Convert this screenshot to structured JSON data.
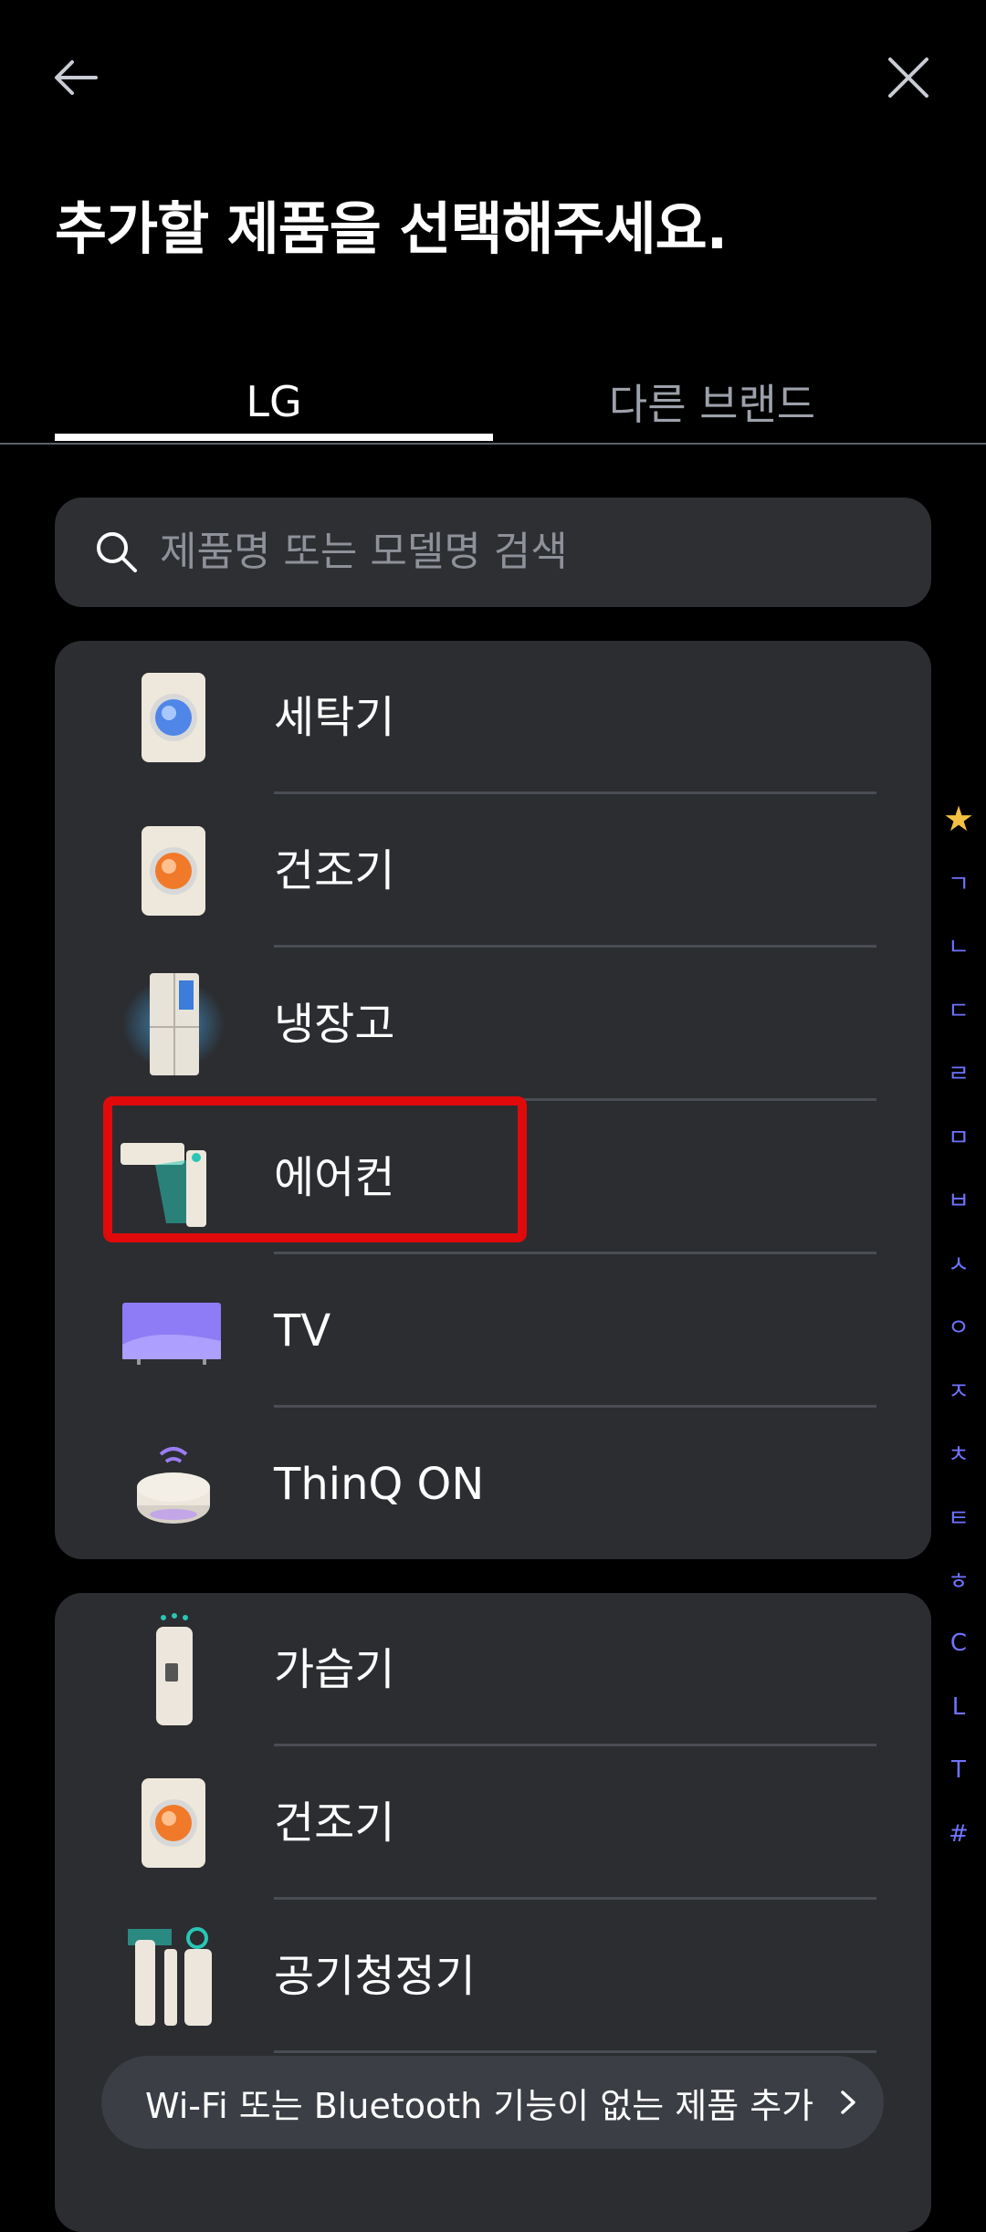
{
  "header": {
    "back_icon": "arrow-left-icon",
    "close_icon": "close-icon",
    "title": "추가할 제품을 선택해주세요."
  },
  "tabs": [
    {
      "label": "LG",
      "selected": true
    },
    {
      "label": "다른 브랜드",
      "selected": false
    }
  ],
  "search": {
    "placeholder": "제품명 또는 모델명 검색",
    "icon": "search-icon"
  },
  "featured": [
    {
      "label": "세탁기",
      "icon": "washer-icon"
    },
    {
      "label": "건조기",
      "icon": "dryer-icon"
    },
    {
      "label": "냉장고",
      "icon": "refrigerator-icon"
    },
    {
      "label": "에어컨",
      "icon": "air-conditioner-icon"
    },
    {
      "label": "TV",
      "icon": "tv-icon"
    },
    {
      "label": "ThinQ ON",
      "icon": "thinq-on-hub-icon"
    }
  ],
  "all_products": [
    {
      "label": "가습기",
      "icon": "humidifier-icon"
    },
    {
      "label": "건조기",
      "icon": "dryer-icon"
    },
    {
      "label": "공기청정기",
      "icon": "air-purifier-icon"
    }
  ],
  "index_bar": [
    "★",
    "ㄱ",
    "ㄴ",
    "ㄷ",
    "ㄹ",
    "ㅁ",
    "ㅂ",
    "ㅅ",
    "ㅇ",
    "ㅈ",
    "ㅊ",
    "ㅌ",
    "ㅎ",
    "C",
    "L",
    "T",
    "#"
  ],
  "bottom_action": {
    "label": "Wi-Fi 또는 Bluetooth 기능이 없는 제품 추가",
    "icon": "chevron-right-icon"
  },
  "colors": {
    "background": "#000000",
    "card": "#2b2d31",
    "index_accent": "#6f73ff",
    "highlight": "#e10a0a"
  }
}
